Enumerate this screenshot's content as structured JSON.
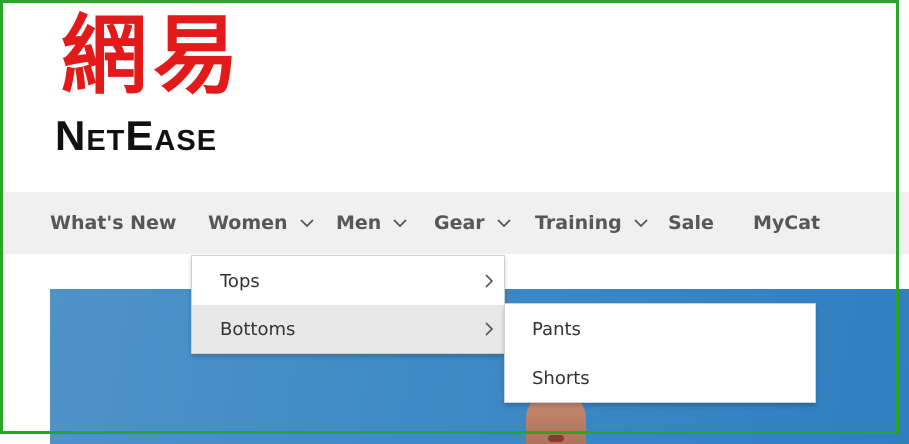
{
  "logo": {
    "cjk_text": "網易",
    "brand_text": "NetEase",
    "colors": {
      "cjk": "#e21a1a",
      "brand": "#111111"
    }
  },
  "nav": {
    "items": [
      {
        "label": "What's New",
        "has_dropdown": false
      },
      {
        "label": "Women",
        "has_dropdown": true
      },
      {
        "label": "Men",
        "has_dropdown": true
      },
      {
        "label": "Gear",
        "has_dropdown": true
      },
      {
        "label": "Training",
        "has_dropdown": true
      },
      {
        "label": "Sale",
        "has_dropdown": false
      },
      {
        "label": "MyCat",
        "has_dropdown": false
      }
    ],
    "icon": "chevron-down-icon"
  },
  "women_menu": {
    "items": [
      {
        "label": "Tops",
        "has_submenu": true,
        "active": false
      },
      {
        "label": "Bottoms",
        "has_submenu": true,
        "active": true
      }
    ],
    "icon": "chevron-right-icon"
  },
  "bottoms_menu": {
    "items": [
      {
        "label": "Pants"
      },
      {
        "label": "Shorts"
      }
    ]
  },
  "colors": {
    "nav_background": "#f0f0f0",
    "nav_text": "#575757",
    "menu_active": "#e8e8e8",
    "hero": "#3f8bc6",
    "frame": "#2aa52a"
  }
}
